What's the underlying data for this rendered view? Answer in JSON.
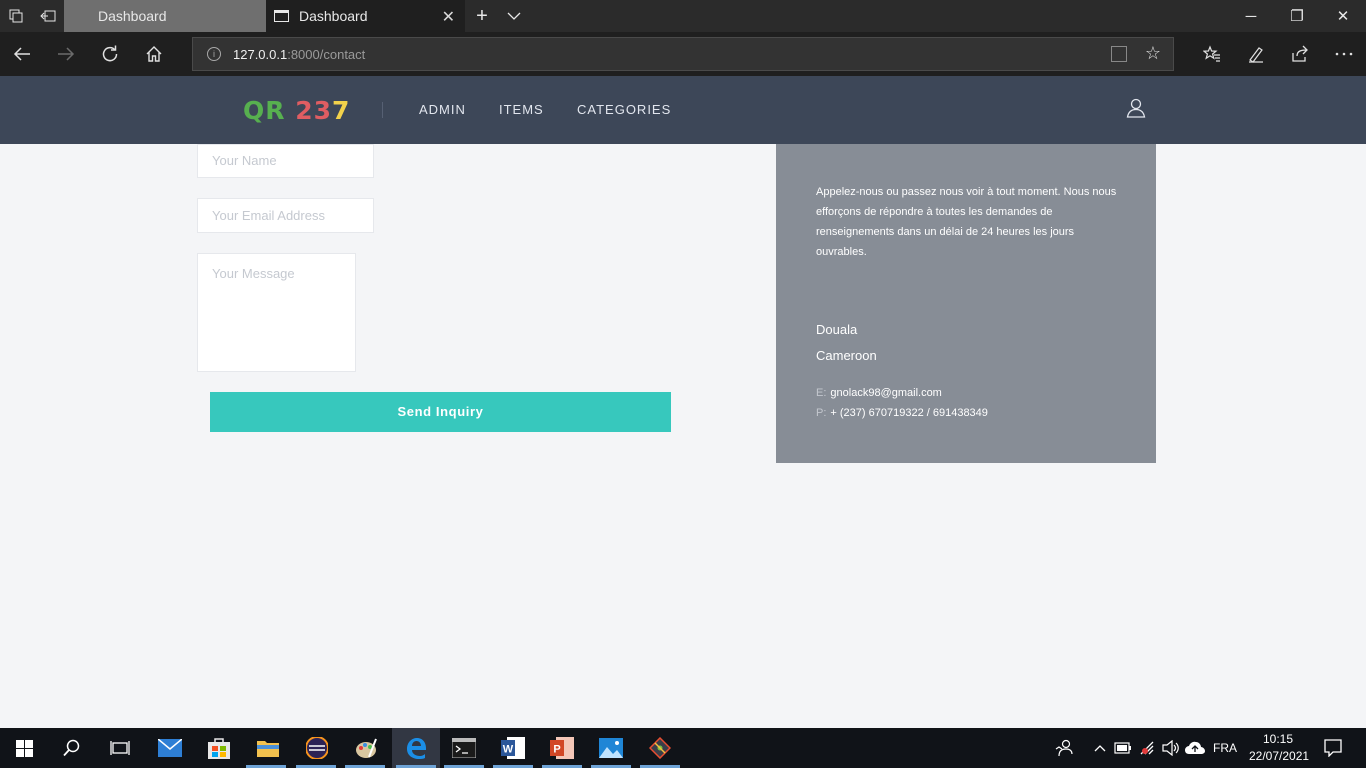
{
  "browser": {
    "tabs": [
      {
        "label": "Dashboard",
        "active": false
      },
      {
        "label": "Dashboard",
        "active": true
      }
    ],
    "tab_close_glyph": "✕",
    "new_tab_glyph": "+",
    "tab_menu_glyph": "⌄",
    "window_buttons": {
      "minimize": "─",
      "restore": "❐",
      "close": "✕"
    },
    "address": {
      "host": "127.0.0.1",
      "rest": ":8000/contact"
    },
    "nav_icons": [
      "back-arrow-icon",
      "forward-arrow-icon",
      "refresh-icon",
      "home-icon"
    ],
    "toolbar_icons": [
      "favorites-icon",
      "pen-icon",
      "share-icon",
      "more-icon"
    ]
  },
  "site": {
    "logo": {
      "part1": "QR ",
      "part2": "23",
      "part3": "7"
    },
    "menu": [
      "ADMIN",
      "ITEMS",
      "CATEGORIES"
    ],
    "colors": {
      "header": "#3d4758",
      "accent": "#37c8bd",
      "panel": "#878d96"
    }
  },
  "form": {
    "name_placeholder": "Your Name",
    "email_placeholder": "Your Email Address",
    "message_placeholder": "Your Message",
    "submit_label": "Send Inquiry"
  },
  "info": {
    "text": "Appelez-nous ou passez nous voir à tout moment. Nous nous efforçons de répondre à toutes les demandes de renseignements dans un délai de 24 heures les jours ouvrables.",
    "city": "Douala",
    "country": "Cameroon",
    "email_label": "E:",
    "email": "gnolack98@gmail.com",
    "phone_label": "P:",
    "phone": "+ (237) 670719322 / 691438349"
  },
  "taskbar": {
    "language": "FRA",
    "time": "10:15",
    "date": "22/07/2021"
  }
}
